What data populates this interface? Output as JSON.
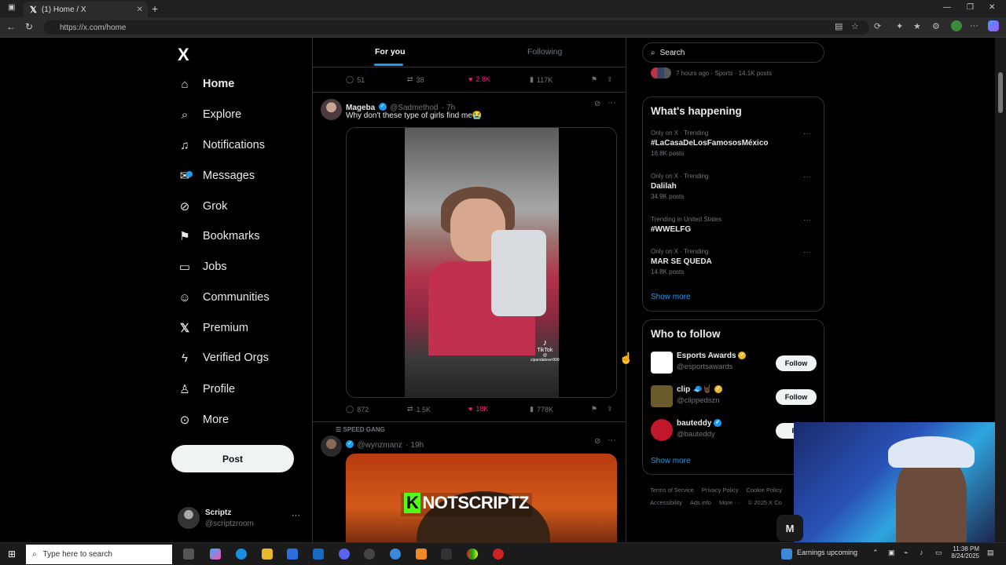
{
  "browser": {
    "tab_title": "(1) Home / X",
    "url": "https://x.com/home"
  },
  "nav": {
    "logo": "X",
    "items": [
      {
        "label": "Home",
        "icon": "home-icon"
      },
      {
        "label": "Explore",
        "icon": "search-icon"
      },
      {
        "label": "Notifications",
        "icon": "bell-icon"
      },
      {
        "label": "Messages",
        "icon": "mail-icon"
      },
      {
        "label": "Grok",
        "icon": "grok-icon"
      },
      {
        "label": "Bookmarks",
        "icon": "bookmark-icon"
      },
      {
        "label": "Jobs",
        "icon": "briefcase-icon"
      },
      {
        "label": "Communities",
        "icon": "people-icon"
      },
      {
        "label": "Premium",
        "icon": "x-icon"
      },
      {
        "label": "Verified Orgs",
        "icon": "lightning-icon"
      },
      {
        "label": "Profile",
        "icon": "person-icon"
      },
      {
        "label": "More",
        "icon": "more-circle-icon"
      }
    ],
    "messages_badge": "1",
    "post_button": "Post",
    "account": {
      "name": "Scriptz",
      "handle": "@scriptzroom"
    }
  },
  "timeline": {
    "tabs": {
      "for_you": "For you",
      "following": "Following"
    },
    "prev_post_actions": {
      "replies": "51",
      "reposts": "38",
      "likes": "2.8K",
      "views": "117K"
    },
    "post1": {
      "name": "Mageba",
      "handle": "@Sadmethod",
      "time": "· 7h",
      "text": "Why don't these type of girls find me😭",
      "tiktok_label": "TikTok",
      "tiktok_user": "@ cipandalover999",
      "actions": {
        "replies": "872",
        "reposts": "1.5K",
        "likes": "18K",
        "views": "778K"
      }
    },
    "post2": {
      "context": "SPEED GANG",
      "handle": "@wynzmanz",
      "time": "· 19h",
      "overlay_k": "K",
      "overlay_text": "NOTSCRIPTZ"
    }
  },
  "sidebar": {
    "search_placeholder": "Search",
    "top_meta": "7 hours ago · Sports · 14.1K posts",
    "happening": {
      "title": "What's happening",
      "trends": [
        {
          "meta": "Only on X · Trending",
          "name": "#LaCasaDeLosFamososMéxico",
          "count": "16.8K posts"
        },
        {
          "meta": "Only on X · Trending",
          "name": "Dalilah",
          "count": "34.9K posts"
        },
        {
          "meta": "Trending in United States",
          "name": "#WWELFG",
          "count": ""
        },
        {
          "meta": "Only on X · Trending",
          "name": "MAR SE QUEDA",
          "count": "14.8K posts"
        }
      ],
      "show_more": "Show more"
    },
    "who_to_follow": {
      "title": "Who to follow",
      "accounts": [
        {
          "name": "Esports Awards",
          "handle": "@esportsawards",
          "follow": "Follow"
        },
        {
          "name": "clip 🧢🤘🏿",
          "handle": "@clippedszn",
          "follow": "Follow"
        },
        {
          "name": "bauteddy",
          "handle": "@bauteddy",
          "follow": "Fo"
        }
      ],
      "show_more": "Show more"
    },
    "footer": {
      "line1": [
        "Terms of Service",
        "Privacy Policy",
        "Cookie Policy"
      ],
      "line2": [
        "Accessibility",
        "Ads info",
        "More ···",
        "© 2025 X Co"
      ]
    },
    "messages_button": "M"
  },
  "taskbar": {
    "search_placeholder": "Type here to search",
    "weather": "Earnings upcoming",
    "time": "11:38 PM",
    "date": "8/24/2025"
  },
  "colors": {
    "accent": "#1d9bf0",
    "like": "#f91880",
    "background": "#000000"
  }
}
